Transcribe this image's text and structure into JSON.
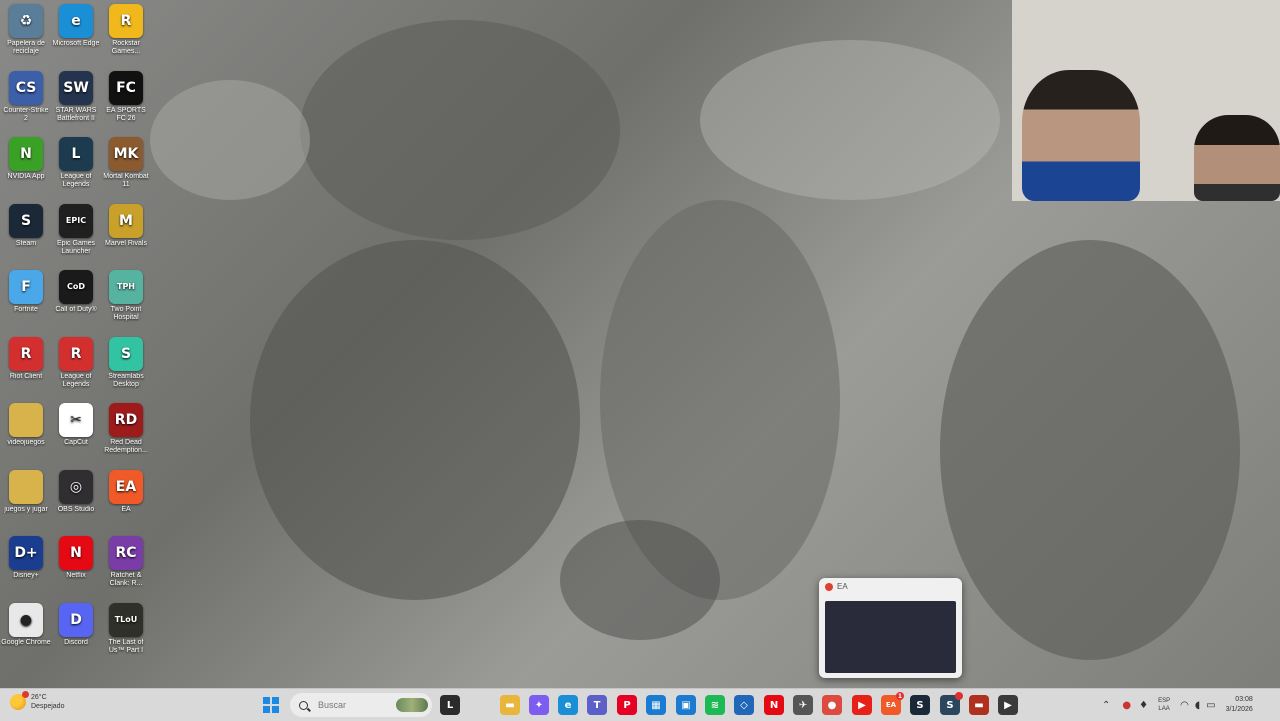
{
  "desktop": {
    "icons": [
      {
        "label": "Papelera de reciclaje",
        "glyph": "♻",
        "color": "#5a7d9a",
        "icon": "recycle-bin-icon"
      },
      {
        "label": "Microsoft Edge",
        "glyph": "e",
        "color": "#1b8fd6",
        "icon": "edge-icon"
      },
      {
        "label": "Rockstar Games...",
        "glyph": "R",
        "color": "#f1b81c",
        "icon": "rockstar-icon"
      },
      {
        "label": "Counter-Strike 2",
        "glyph": "CS",
        "color": "#3b5fa8",
        "icon": "counter-strike-icon"
      },
      {
        "label": "STAR WARS Battlefront II",
        "glyph": "SW",
        "color": "#24344f",
        "icon": "star-wars-icon"
      },
      {
        "label": "EA SPORTS FC 26",
        "glyph": "FC",
        "color": "#111111",
        "icon": "fc26-icon"
      },
      {
        "label": "NVIDIA App",
        "glyph": "N",
        "color": "#39a125",
        "icon": "nvidia-icon"
      },
      {
        "label": "League of Legends",
        "glyph": "L",
        "color": "#1d3b4f",
        "icon": "league-icon"
      },
      {
        "label": "Mortal Kombat 11",
        "glyph": "MK",
        "color": "#8b5a2e",
        "icon": "mortal-kombat-icon"
      },
      {
        "label": "Steam",
        "glyph": "S",
        "color": "#1b2838",
        "icon": "steam-icon"
      },
      {
        "label": "Epic Games Launcher",
        "glyph": "EPIC",
        "color": "#202020",
        "icon": "epic-games-icon"
      },
      {
        "label": "Marvel Rivals",
        "glyph": "M",
        "color": "#c9a02a",
        "icon": "marvel-rivals-icon"
      },
      {
        "label": "Fortnite",
        "glyph": "F",
        "color": "#4aa7e8",
        "icon": "fortnite-icon"
      },
      {
        "label": "Call of Duty®",
        "glyph": "CoD",
        "color": "#1a1a1a",
        "icon": "call-of-duty-icon"
      },
      {
        "label": "Two Point Hospital",
        "glyph": "TPH",
        "color": "#56b3a0",
        "icon": "two-point-icon"
      },
      {
        "label": "Riot Client",
        "glyph": "R",
        "color": "#d32f2f",
        "icon": "riot-client-icon"
      },
      {
        "label": "League of Legends",
        "glyph": "R",
        "color": "#d32f2f",
        "icon": "riot-league-icon"
      },
      {
        "label": "Streamlabs Desktop",
        "glyph": "S",
        "color": "#31c3a2",
        "icon": "streamlabs-icon"
      },
      {
        "label": "videojuegos",
        "glyph": "",
        "color": "#d8b24a",
        "icon": "folder-icon"
      },
      {
        "label": "CapCut",
        "glyph": "✂",
        "color": "#ffffff",
        "icon": "capcut-icon"
      },
      {
        "label": "Red Dead Redemption...",
        "glyph": "RD",
        "color": "#9e1b1b",
        "icon": "red-dead-icon"
      },
      {
        "label": "juegos y jugar",
        "glyph": "",
        "color": "#d8b24a",
        "icon": "folder-icon"
      },
      {
        "label": "OBS Studio",
        "glyph": "◎",
        "color": "#302e31",
        "icon": "obs-icon"
      },
      {
        "label": "EA",
        "glyph": "EA",
        "color": "#f05a28",
        "icon": "ea-icon"
      },
      {
        "label": "Disney+",
        "glyph": "D+",
        "color": "#1a3d8f",
        "icon": "disney-plus-icon"
      },
      {
        "label": "Netflix",
        "glyph": "N",
        "color": "#e50914",
        "icon": "netflix-icon"
      },
      {
        "label": "Ratchet & Clank: R...",
        "glyph": "RC",
        "color": "#7a3da8",
        "icon": "ratchet-icon"
      },
      {
        "label": "Google Chrome",
        "glyph": "●",
        "color": "#e8e8e8",
        "icon": "chrome-icon"
      },
      {
        "label": "Discord",
        "glyph": "D",
        "color": "#5865f2",
        "icon": "discord-icon"
      },
      {
        "label": "The Last of Us™ Part I",
        "glyph": "TLoU",
        "color": "#30302a",
        "icon": "last-of-us-icon"
      }
    ]
  },
  "popup": {
    "title": "EA"
  },
  "taskbar": {
    "weather": {
      "temp": "26°C",
      "condition": "Despejado"
    },
    "search_placeholder": "Buscar",
    "apps": [
      {
        "icon": "terminal-icon",
        "glyph": "L",
        "color": "#2b2b2b"
      },
      {
        "icon": "file-explorer-icon",
        "glyph": "▬",
        "color": "#e7b63b"
      },
      {
        "icon": "copilot-icon",
        "glyph": "✦",
        "color": "#7d5cf2"
      },
      {
        "icon": "edge-icon",
        "glyph": "e",
        "color": "#1b8fd6"
      },
      {
        "icon": "teams-icon",
        "glyph": "T",
        "color": "#5b5fc7"
      },
      {
        "icon": "pinterest-icon",
        "glyph": "P",
        "color": "#e60023"
      },
      {
        "icon": "store-icon",
        "glyph": "▦",
        "color": "#1a7bd1"
      },
      {
        "icon": "photos-icon",
        "glyph": "▣",
        "color": "#1a7bd1"
      },
      {
        "icon": "spotify-icon",
        "glyph": "≋",
        "color": "#1db954"
      },
      {
        "icon": "vscode-icon",
        "glyph": "◇",
        "color": "#2067b8"
      },
      {
        "icon": "netflix-icon",
        "glyph": "N",
        "color": "#e50914"
      },
      {
        "icon": "game-icon",
        "glyph": "✈",
        "color": "#555555"
      },
      {
        "icon": "chrome-icon",
        "glyph": "●",
        "color": "#dd4a3e"
      },
      {
        "icon": "youtube-icon",
        "glyph": "▶",
        "color": "#e62117"
      },
      {
        "icon": "ea-app-icon",
        "glyph": "EA",
        "color": "#f05a28",
        "badge": "1"
      },
      {
        "icon": "steam-icon",
        "glyph": "S",
        "color": "#1b2838"
      },
      {
        "icon": "steam-alt-icon",
        "glyph": "S",
        "color": "#2a475e",
        "badge": " "
      },
      {
        "icon": "screen-record-icon",
        "glyph": "▬",
        "color": "#b03020"
      },
      {
        "icon": "media-player-icon",
        "glyph": "▶",
        "color": "#3a3a3a"
      }
    ],
    "lang_top": "ESP",
    "lang_bottom": "LAA",
    "time": "03:08",
    "date": "3/1/2026"
  }
}
